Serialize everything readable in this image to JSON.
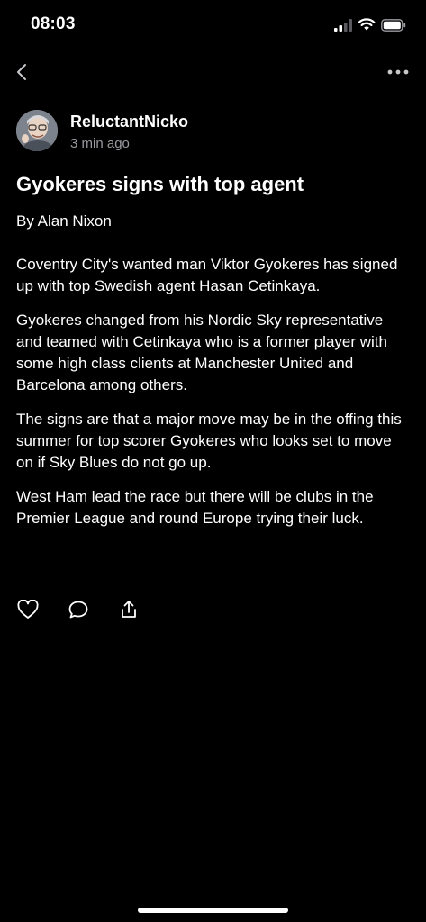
{
  "status_bar": {
    "time": "08:03",
    "icons": [
      "cellular-signal-icon",
      "wifi-icon",
      "battery-icon"
    ]
  },
  "nav": {
    "back_icon": "chevron-left-icon",
    "more_icon": "more-horizontal-icon"
  },
  "post": {
    "author": "ReluctantNicko",
    "time_ago": "3 min ago",
    "title": "Gyokeres signs with top agent",
    "byline": "By Alan Nixon",
    "paragraphs": [
      "Coventry City's wanted man Viktor Gyokeres has signed up with top Swedish agent Hasan Cetinkaya.",
      "Gyokeres changed from his Nordic Sky representative and teamed with Cetinkaya who is a former player with some high class clients at Manchester United and Barcelona among others.",
      "The signs are that a major move may be in the offing this summer for top scorer Gyokeres who looks set to move on if Sky Blues do not go up.",
      "West Ham lead the race but there will be clubs in the Premier League and round Europe trying their luck."
    ]
  },
  "actions": [
    "heart-icon",
    "comment-icon",
    "share-icon"
  ],
  "colors": {
    "background": "#000000",
    "text": "#ffffff",
    "secondary_text": "#9a9aa0"
  }
}
